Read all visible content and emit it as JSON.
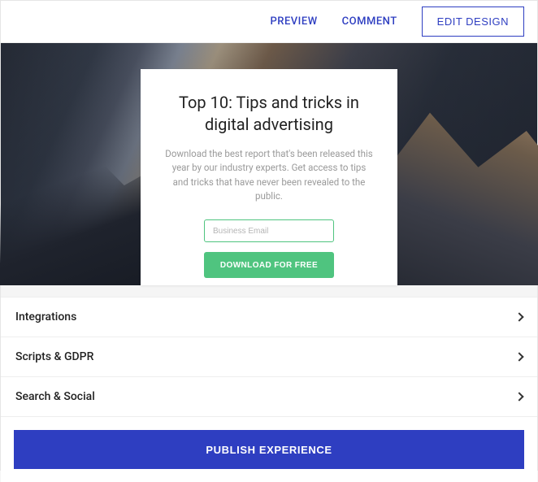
{
  "toolbar": {
    "preview": "PREVIEW",
    "comment": "COMMENT",
    "edit_design": "EDIT DESIGN"
  },
  "card": {
    "title": "Top 10: Tips and tricks in digital advertising",
    "description": "Download the best report that's been released this year by our industry experts. Get access to tips and tricks that have never been revealed to the public.",
    "email_placeholder": "Business Email",
    "cta": "DOWNLOAD FOR FREE"
  },
  "accordion": {
    "items": [
      {
        "label": "Integrations"
      },
      {
        "label": "Scripts & GDPR"
      },
      {
        "label": "Search & Social"
      }
    ]
  },
  "footer": {
    "publish": "PUBLISH EXPERIENCE"
  }
}
